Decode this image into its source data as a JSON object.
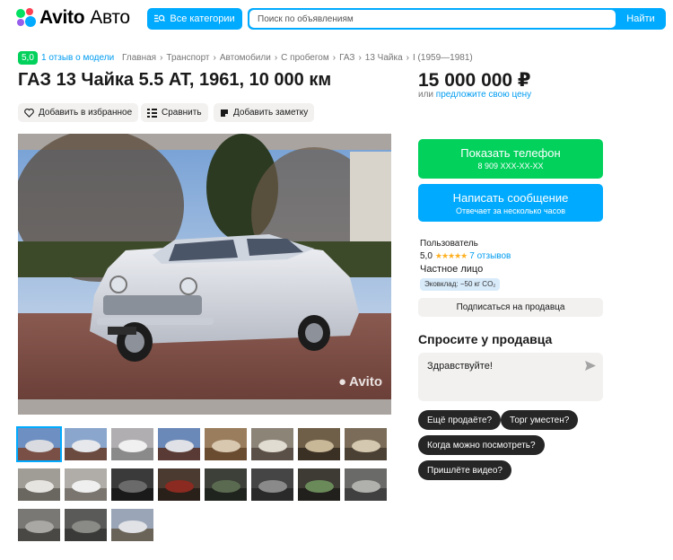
{
  "header": {
    "logo_text": "Avito",
    "logo_suffix": "Авто",
    "categories_label": "Все категории",
    "search_placeholder": "Поиск по объявлениям",
    "search_button": "Найти"
  },
  "breadcrumbs": {
    "rating": "5,0",
    "reviews_link": "1 отзыв о модели",
    "items": [
      "Главная",
      "Транспорт",
      "Автомобили",
      "С пробегом",
      "ГАЗ",
      "13 Чайка",
      "I (1959—1981)"
    ]
  },
  "listing": {
    "title": "ГАЗ 13 Чайка 5.5 AT, 1961, 10 000 км",
    "price": "15 000 000 ₽",
    "price_or": "или",
    "price_offer_link": "предложите свою цену",
    "actions": {
      "favorite": "Добавить в избранное",
      "compare": "Сравнить",
      "note": "Добавить заметку"
    },
    "photo_watermark": "Avito",
    "thumb_count": 19,
    "active_thumb": 0
  },
  "contact": {
    "show_phone": "Показать телефон",
    "phone_masked": "8 909 XXX-XX-XX",
    "write_message": "Написать сообщение",
    "reply_time": "Отвечает за несколько часов"
  },
  "seller": {
    "role": "Пользователь",
    "rating": "5,0",
    "stars": "★★★★★",
    "reviews": "7 отзывов",
    "type": "Частное лицо",
    "eco": "Эковклад: −50 кг CO₂",
    "subscribe": "Подписаться на продавца"
  },
  "ask": {
    "title": "Спросите у продавца",
    "message": "Здравствуйте!",
    "chips": [
      "Ещё продаёте?",
      "Торг уместен?",
      "Когда можно посмотреть?",
      "Пришлёте видео?"
    ]
  },
  "colors": {
    "accent_blue": "#00aaff",
    "accent_green": "#02d15c",
    "link": "#009cf0"
  }
}
